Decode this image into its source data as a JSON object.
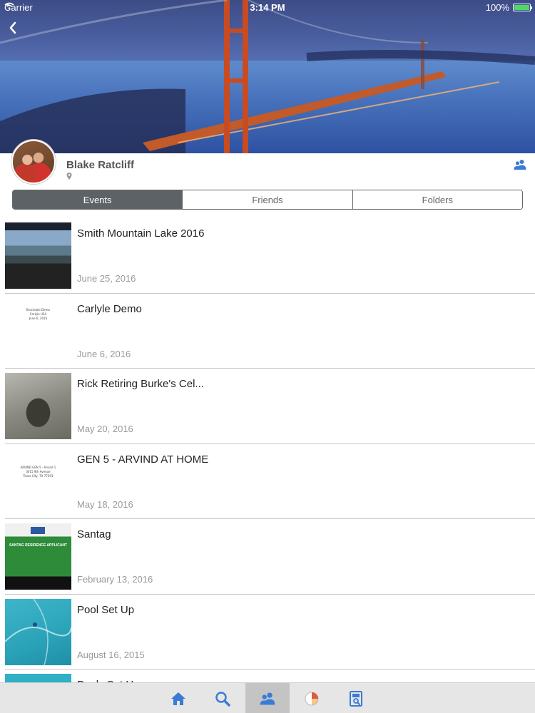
{
  "status": {
    "carrier": "Carrier",
    "time": "3:14 PM",
    "battery": "100%"
  },
  "profile": {
    "name": "Blake Ratcliff"
  },
  "segments": {
    "events": "Events",
    "friends": "Friends",
    "folders": "Folders",
    "selected": "Events"
  },
  "events": [
    {
      "title": "Smith Mountain Lake 2016",
      "date": "June 25, 2016"
    },
    {
      "title": "Carlyle Demo",
      "date": "June 6, 2016",
      "thumb_lines": [
        "Brockdale Demo",
        "Carlyle USA",
        "June 6, 2016"
      ]
    },
    {
      "title": "Rick Retiring Burke's Cel...",
      "date": "May 20, 2016"
    },
    {
      "title": "GEN 5 - ARVIND AT HOME",
      "date": "May 18, 2016",
      "thumb_lines": [
        "ARVIND GEN 5 - Arvind 1",
        "3015 9th Avenue",
        "Texas City, TX 77591"
      ]
    },
    {
      "title": "Santag",
      "date": "February 13, 2016",
      "thumb_banner": "SANTAG RESIDENCE APPLICANT"
    },
    {
      "title": "Pool Set Up",
      "date": "August 16, 2015"
    },
    {
      "title": "Pools Set U..."
    }
  ],
  "tabbar": {
    "items": [
      "home-icon",
      "search-icon",
      "friends-icon",
      "pie-chart-icon",
      "album-icon"
    ],
    "selected": "friends-icon"
  },
  "colors": {
    "accent": "#3a7bd5",
    "segment_active": "#5d6266",
    "date_text": "#999999"
  }
}
